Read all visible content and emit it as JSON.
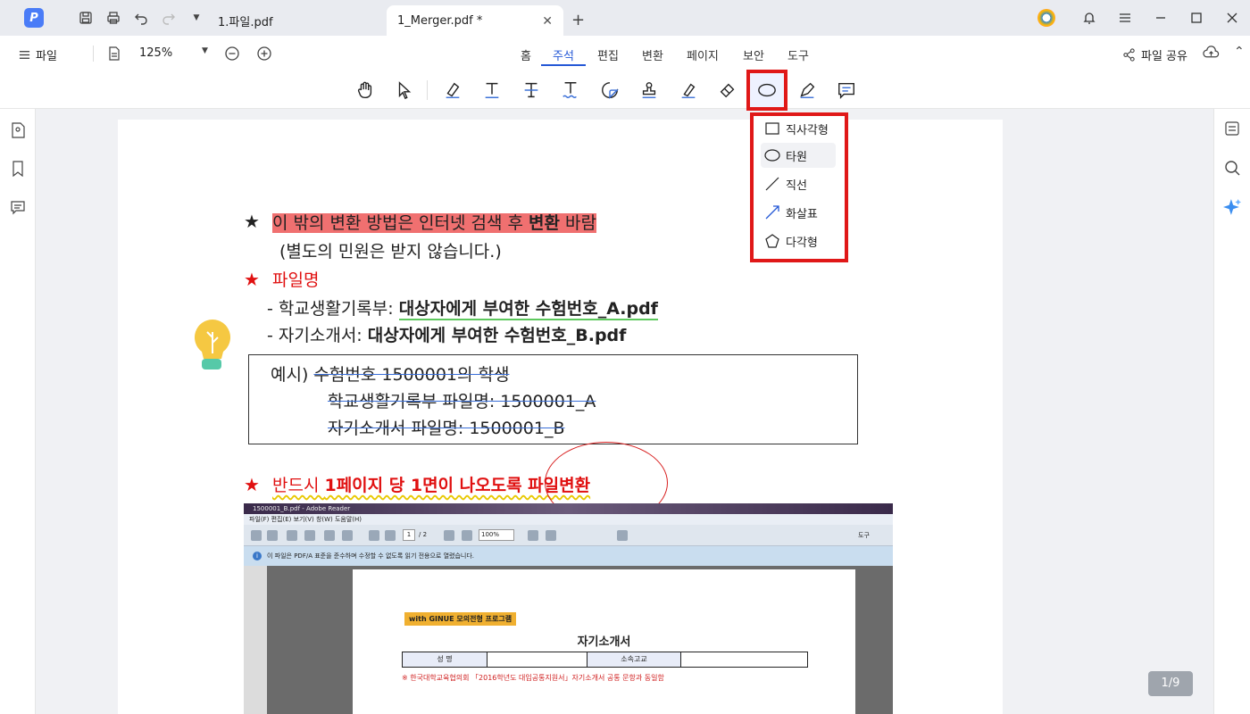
{
  "app": {
    "logo_letter": "P"
  },
  "tabs": [
    {
      "label": "1.파일.pdf"
    },
    {
      "label": "1_Merger.pdf *"
    }
  ],
  "menubar": {
    "file_label": "파일",
    "zoom": "125%",
    "tabs": [
      "홈",
      "주석",
      "편집",
      "변환",
      "페이지",
      "보안",
      "도구"
    ],
    "active_tab": "주석",
    "share_label": "파일 공유"
  },
  "shape_menu": {
    "items": [
      {
        "label": "직사각형",
        "icon": "rectangle-icon"
      },
      {
        "label": "타원",
        "icon": "ellipse-icon"
      },
      {
        "label": "직선",
        "icon": "line-icon"
      },
      {
        "label": "화살표",
        "icon": "arrow-icon"
      },
      {
        "label": "다각형",
        "icon": "polygon-icon"
      }
    ],
    "hovered": "타원"
  },
  "document": {
    "line1_star": "★",
    "line1_a": "이 밖의 변환 방법은 인터넷 검색 후 ",
    "line1_b": "변환",
    "line1_c": " 바람",
    "line2": "(별도의 민원은 받지 않습니다.)",
    "line3_star": "★",
    "line3": "파일명",
    "line4_a": "-  학교생활기록부: ",
    "line4_b": "대상자에게 부여한 수험번호_A.pdf",
    "line5_a": "-  자기소개서: ",
    "line5_b": "대상자에게 부여한 수험번호_B.pdf",
    "ex_line1_a": "예시)  ",
    "ex_line1_b": "수험번호 1500001의 학생",
    "ex_line2": "학교생활기록부 파일명: 1500001_A",
    "ex_line3": "자기소개서 파일명: 1500001_B",
    "line6_star": "★",
    "line6_a": "반드시 ",
    "line6_b": "1페이지 당 1면이 나오도록 파일변환"
  },
  "embedded": {
    "window_title": "1500001_B.pdf - Adobe Reader",
    "menu": "파일(F)   편집(E)   보기(V)   창(W)   도움말(H)",
    "page_num": "1",
    "page_total": "/ 2",
    "zoom": "100%",
    "tools_label": "도구",
    "info": "이 파일은 PDF/A 표준을 준수하며 수정할 수 없도록 읽기 전용으로 열렸습니다.",
    "badge": "with GINUE 모의전형 프로그램",
    "doc_title": "자기소개서",
    "table": [
      "성       명",
      "",
      "소속고교",
      ""
    ],
    "note": "※  한국대학교육협의회 「2016학년도 대입공통지원서」자기소개서 공통 문항과 동일함"
  },
  "page_indicator": "1/9",
  "colors": {
    "accent": "#2458d6",
    "highlight_red": "#e01818"
  }
}
